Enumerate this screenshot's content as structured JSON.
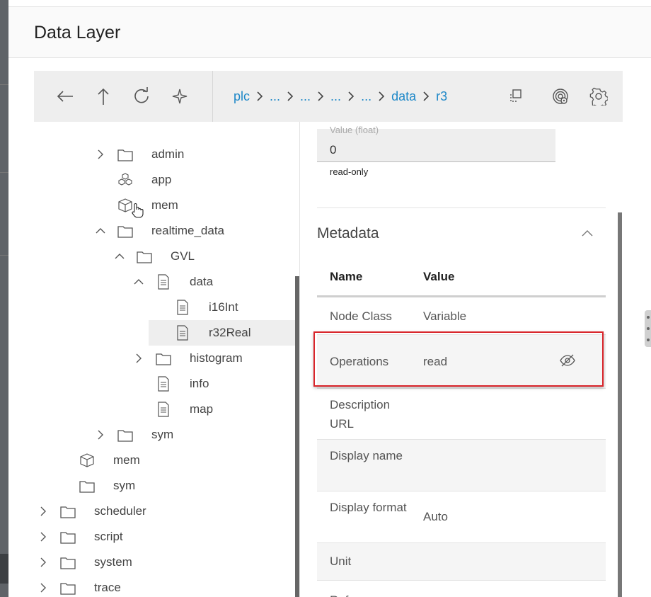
{
  "dialog": {
    "title": "Data Layer"
  },
  "toolbar": {
    "back_icon": "arrow-left-icon",
    "up_icon": "arrow-up-icon",
    "refresh_icon": "refresh-icon",
    "sparkle_icon": "sparkle-icon",
    "breadcrumbs": [
      "plc",
      "...",
      "...",
      "...",
      "...",
      "data",
      "r3"
    ],
    "copy_icon": "copy-icon",
    "fingerprint_icon": "fingerprint-icon",
    "settings_icon": "gear-icon"
  },
  "tree": {
    "items": [
      {
        "label": "admin",
        "icon": "folder",
        "chevron": "right"
      },
      {
        "label": "app",
        "icon": "cubes",
        "chevron": ""
      },
      {
        "label": "mem",
        "icon": "cube",
        "chevron": ""
      },
      {
        "label": "realtime_data",
        "icon": "folder",
        "chevron": "up"
      },
      {
        "label": "GVL",
        "icon": "folder",
        "chevron": "up"
      },
      {
        "label": "data",
        "icon": "file",
        "chevron": "up"
      },
      {
        "label": "i16Int",
        "icon": "file",
        "chevron": ""
      },
      {
        "label": "r32Real",
        "icon": "file",
        "chevron": "",
        "selected": true
      },
      {
        "label": "histogram",
        "icon": "folder",
        "chevron": "right"
      },
      {
        "label": "info",
        "icon": "file",
        "chevron": ""
      },
      {
        "label": "map",
        "icon": "file",
        "chevron": ""
      },
      {
        "label": "sym",
        "icon": "folder",
        "chevron": "right"
      },
      {
        "label": "mem",
        "icon": "cube",
        "chevron": ""
      },
      {
        "label": "sym",
        "icon": "folder",
        "chevron": ""
      },
      {
        "label": "scheduler",
        "icon": "folder",
        "chevron": "right"
      },
      {
        "label": "script",
        "icon": "folder",
        "chevron": "right"
      },
      {
        "label": "system",
        "icon": "folder",
        "chevron": "right"
      },
      {
        "label": "trace",
        "icon": "folder",
        "chevron": "right"
      }
    ]
  },
  "value_panel": {
    "label_cut": "Value (float)",
    "value": "0",
    "readonly": "read-only"
  },
  "metadata": {
    "title": "Metadata",
    "col_name": "Name",
    "col_value": "Value",
    "rows": [
      {
        "name": "Node Class",
        "value": "Variable"
      },
      {
        "name": "Operations",
        "value": "read"
      },
      {
        "name": "Description URL",
        "value": ""
      },
      {
        "name": "Display name",
        "value": ""
      },
      {
        "name": "Display format",
        "value": "Auto"
      },
      {
        "name": "Unit",
        "value": ""
      },
      {
        "name": "Refe...",
        "value": ""
      }
    ]
  },
  "colors": {
    "accent": "#1e88c8",
    "highlight": "#d9252b",
    "selected": "#eeeeee"
  }
}
